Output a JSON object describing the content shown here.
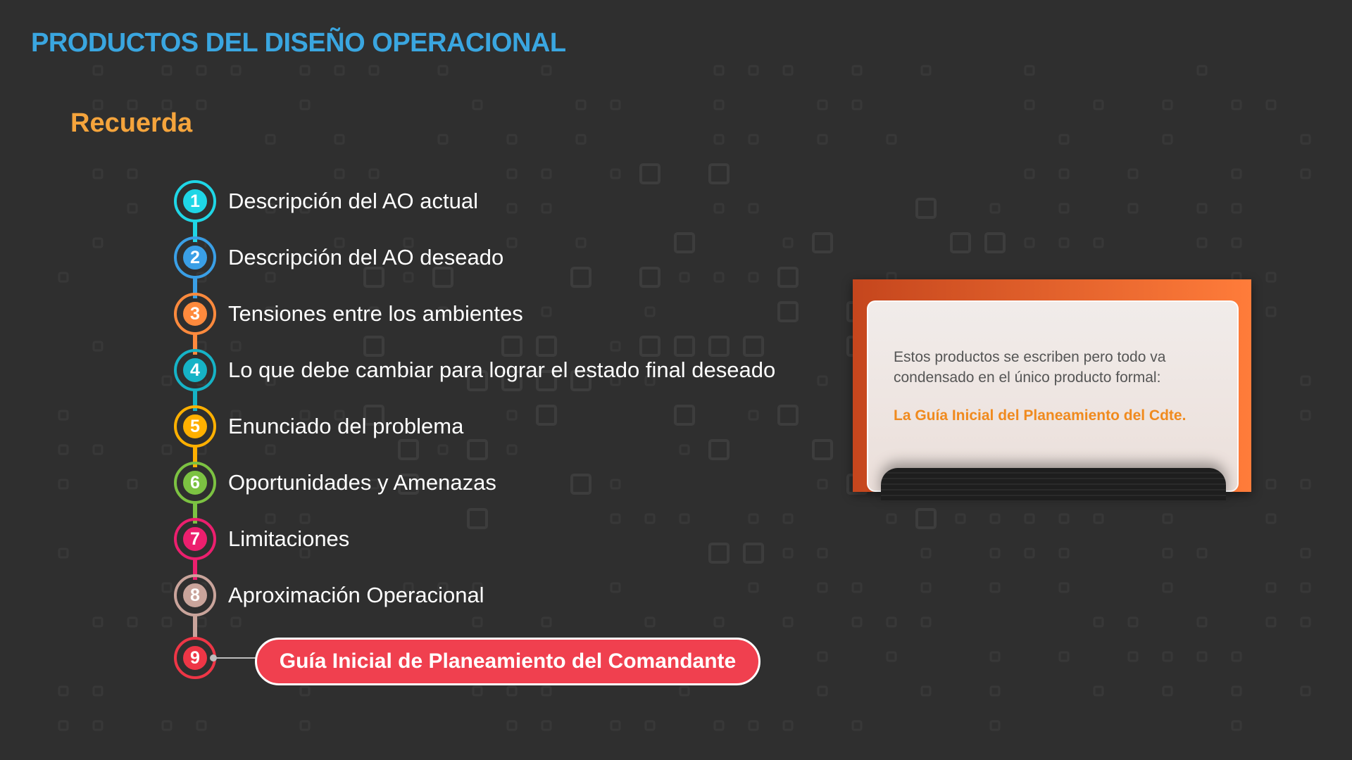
{
  "header": {
    "title": "PRODUCTOS DEL DISEÑO OPERACIONAL"
  },
  "section": {
    "title": "Recuerda"
  },
  "steps": [
    {
      "number": "1",
      "label": "Descripción del AO actual",
      "color": "#1fd6e6"
    },
    {
      "number": "2",
      "label": "Descripción del AO deseado",
      "color": "#3a9fe6"
    },
    {
      "number": "3",
      "label": "Tensiones entre los ambientes",
      "color": "#ff8a3d"
    },
    {
      "number": "4",
      "label": "Lo que debe cambiar para lograr el estado final deseado",
      "color": "#16b3c6"
    },
    {
      "number": "5",
      "label": "Enunciado del problema",
      "color": "#ffb000"
    },
    {
      "number": "6",
      "label": "Oportunidades y Amenazas",
      "color": "#7cc242"
    },
    {
      "number": "7",
      "label": "Limitaciones",
      "color": "#ec1f6e"
    },
    {
      "number": "8",
      "label": "Aproximación Operacional",
      "color": "#c9a49b"
    },
    {
      "number": "9",
      "label": "",
      "color": "#ee3646"
    }
  ],
  "highlight": {
    "label": "Guía Inicial de Planeamiento del Comandante",
    "color": "#f0404f"
  },
  "card": {
    "body": "Estos productos se escriben pero todo va condensado en el único producto formal:",
    "highlight": "La Guía Inicial del Planeamiento del Cdte.",
    "highlight_color": "#f08a1e",
    "frame_gradient": [
      "#c5461d",
      "#ff7c3a"
    ]
  },
  "theme": {
    "background": "#2f2f2f",
    "title_color": "#3aa6e0",
    "section_color": "#f5a43c"
  }
}
